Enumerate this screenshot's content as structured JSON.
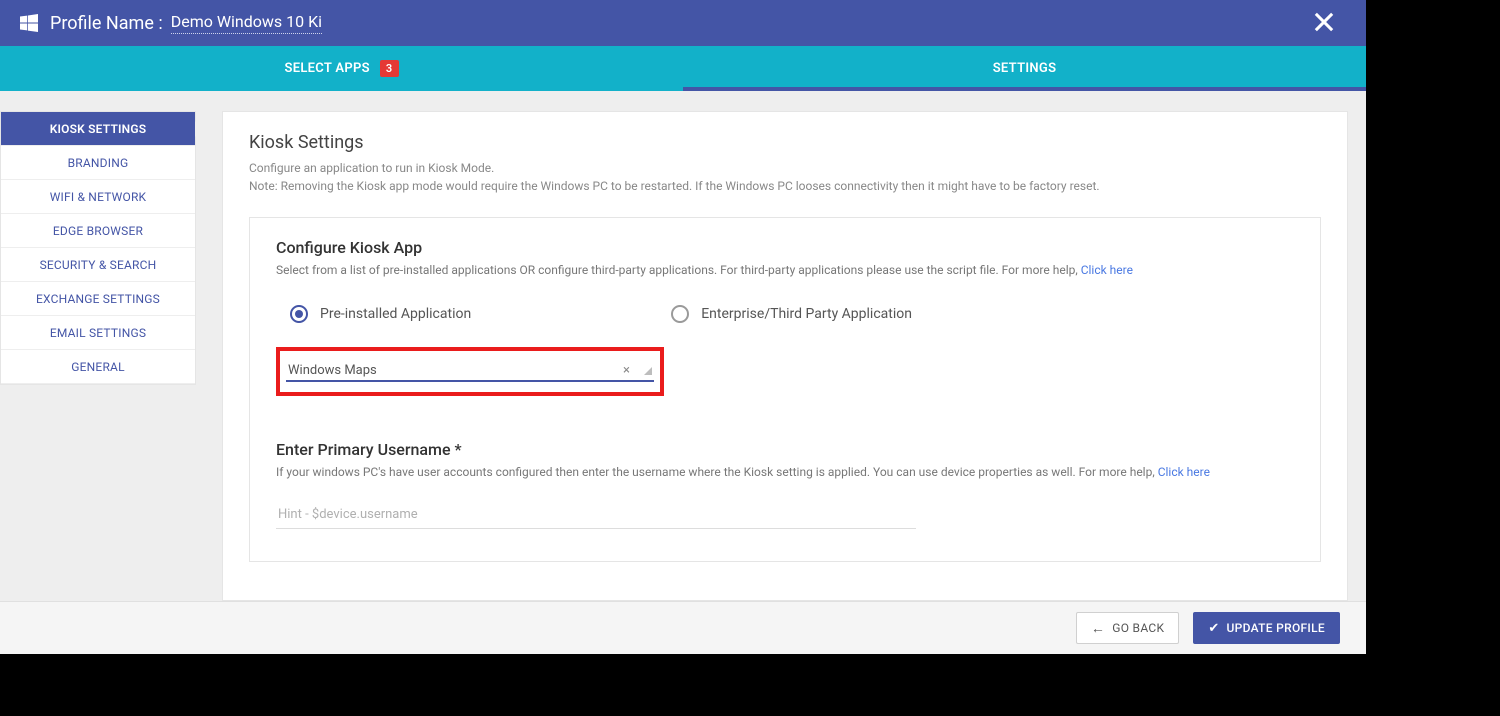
{
  "header": {
    "title_label": "Profile Name :",
    "profile_name": "Demo Windows 10 Ki"
  },
  "tabs": {
    "select_apps": {
      "label": "SELECT APPS",
      "badge": "3"
    },
    "settings": {
      "label": "SETTINGS"
    }
  },
  "sidebar": {
    "items": [
      {
        "label": "KIOSK SETTINGS",
        "active": true
      },
      {
        "label": "BRANDING"
      },
      {
        "label": "WIFI & NETWORK"
      },
      {
        "label": "EDGE BROWSER"
      },
      {
        "label": "SECURITY & SEARCH"
      },
      {
        "label": "EXCHANGE SETTINGS"
      },
      {
        "label": "EMAIL SETTINGS"
      },
      {
        "label": "GENERAL"
      }
    ]
  },
  "main": {
    "title": "Kiosk Settings",
    "desc_line1": "Configure an application to run in Kiosk Mode.",
    "desc_line2": "Note: Removing the Kiosk app mode would require the Windows PC to be restarted. If the Windows PC looses connectivity then it might have to be factory reset.",
    "configure": {
      "title": "Configure Kiosk App",
      "desc": "Select from a list of pre-installed applications OR configure third-party applications. For third-party applications please use the script file. For more help, ",
      "link": "Click here",
      "radio_preinstalled": "Pre-installed Application",
      "radio_enterprise": "Enterprise/Third Party Application",
      "selected_app": "Windows Maps"
    },
    "username": {
      "title": "Enter Primary Username *",
      "desc": "If your windows PC's have user accounts configured then enter the username where the Kiosk setting is applied. You can use device properties as well. For more help, ",
      "link": "Click here",
      "placeholder": "Hint - $device.username"
    }
  },
  "footer": {
    "goback": "GO BACK",
    "update": "UPDATE PROFILE"
  }
}
